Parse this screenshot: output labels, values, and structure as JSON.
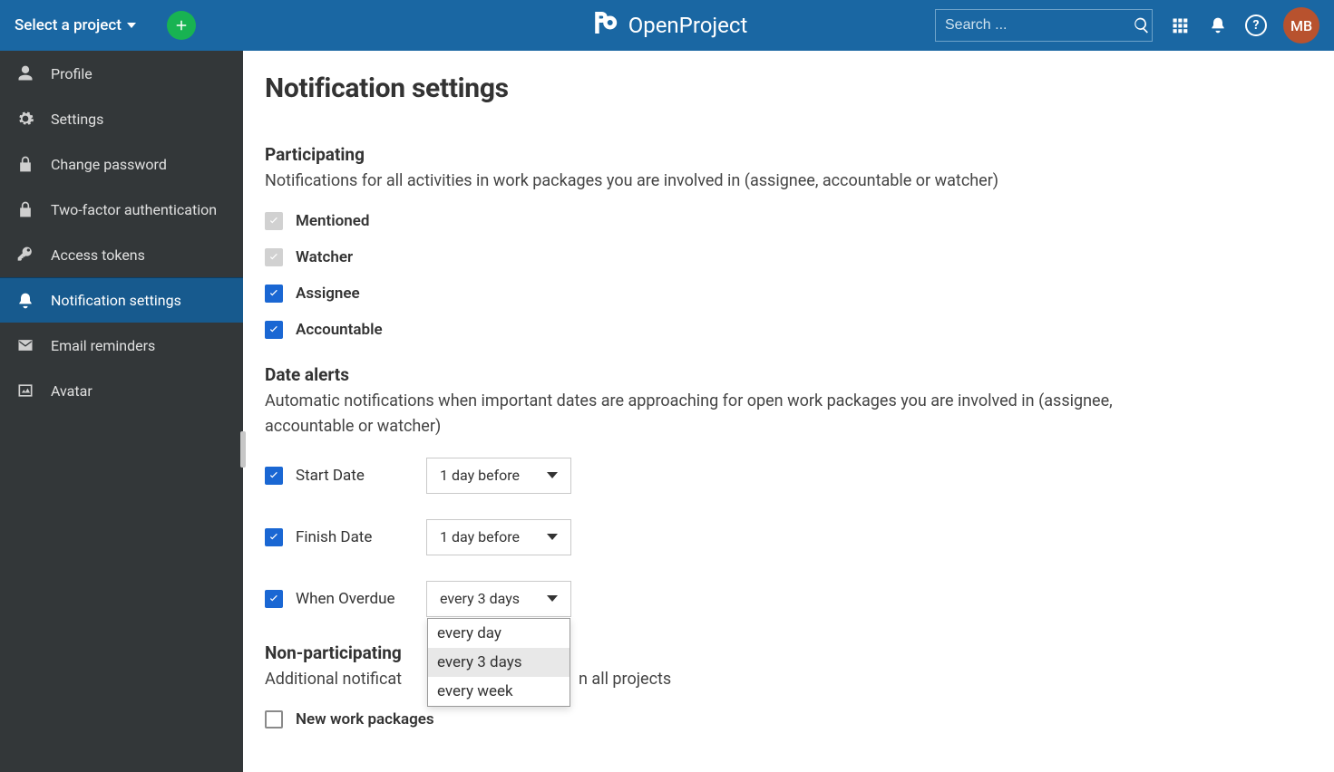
{
  "header": {
    "project_selector": "Select a project",
    "brand": "OpenProject",
    "search_placeholder": "Search ...",
    "avatar_initials": "MB"
  },
  "sidebar": {
    "items": [
      {
        "id": "profile",
        "label": "Profile",
        "icon": "user"
      },
      {
        "id": "settings",
        "label": "Settings",
        "icon": "gears"
      },
      {
        "id": "change-password",
        "label": "Change password",
        "icon": "lock"
      },
      {
        "id": "two-factor",
        "label": "Two-factor authentication",
        "icon": "lock"
      },
      {
        "id": "access-tokens",
        "label": "Access tokens",
        "icon": "key"
      },
      {
        "id": "notification-settings",
        "label": "Notification settings",
        "icon": "bell",
        "active": true
      },
      {
        "id": "email-reminders",
        "label": "Email reminders",
        "icon": "mail"
      },
      {
        "id": "avatar",
        "label": "Avatar",
        "icon": "image"
      }
    ]
  },
  "page": {
    "title": "Notification settings",
    "participating": {
      "heading": "Participating",
      "desc": "Notifications for all activities in work packages you are involved in (assignee, accountable or watcher)",
      "checks": [
        {
          "id": "mentioned",
          "label": "Mentioned",
          "state": "disabled-checked"
        },
        {
          "id": "watcher",
          "label": "Watcher",
          "state": "disabled-checked"
        },
        {
          "id": "assignee",
          "label": "Assignee",
          "state": "checked"
        },
        {
          "id": "accountable",
          "label": "Accountable",
          "state": "checked"
        }
      ]
    },
    "datealerts": {
      "heading": "Date alerts",
      "desc": "Automatic notifications when important dates are approaching for open work packages you are involved in (assignee, accountable or watcher)",
      "rows": [
        {
          "id": "start-date",
          "label": "Start Date",
          "state": "checked",
          "value": "1 day before"
        },
        {
          "id": "finish-date",
          "label": "Finish Date",
          "state": "checked",
          "value": "1 day before"
        },
        {
          "id": "when-overdue",
          "label": "When Overdue",
          "state": "checked",
          "value": "every 3 days",
          "open": true,
          "options": [
            "every day",
            "every 3 days",
            "every week"
          ],
          "highlight": "every 3 days"
        }
      ]
    },
    "nonparticipating": {
      "heading": "Non-participating",
      "desc_prefix": "Additional notificat",
      "desc_suffix": "n all projects",
      "checks": [
        {
          "id": "new-wp",
          "label": "New work packages",
          "state": "unchecked"
        }
      ]
    }
  }
}
